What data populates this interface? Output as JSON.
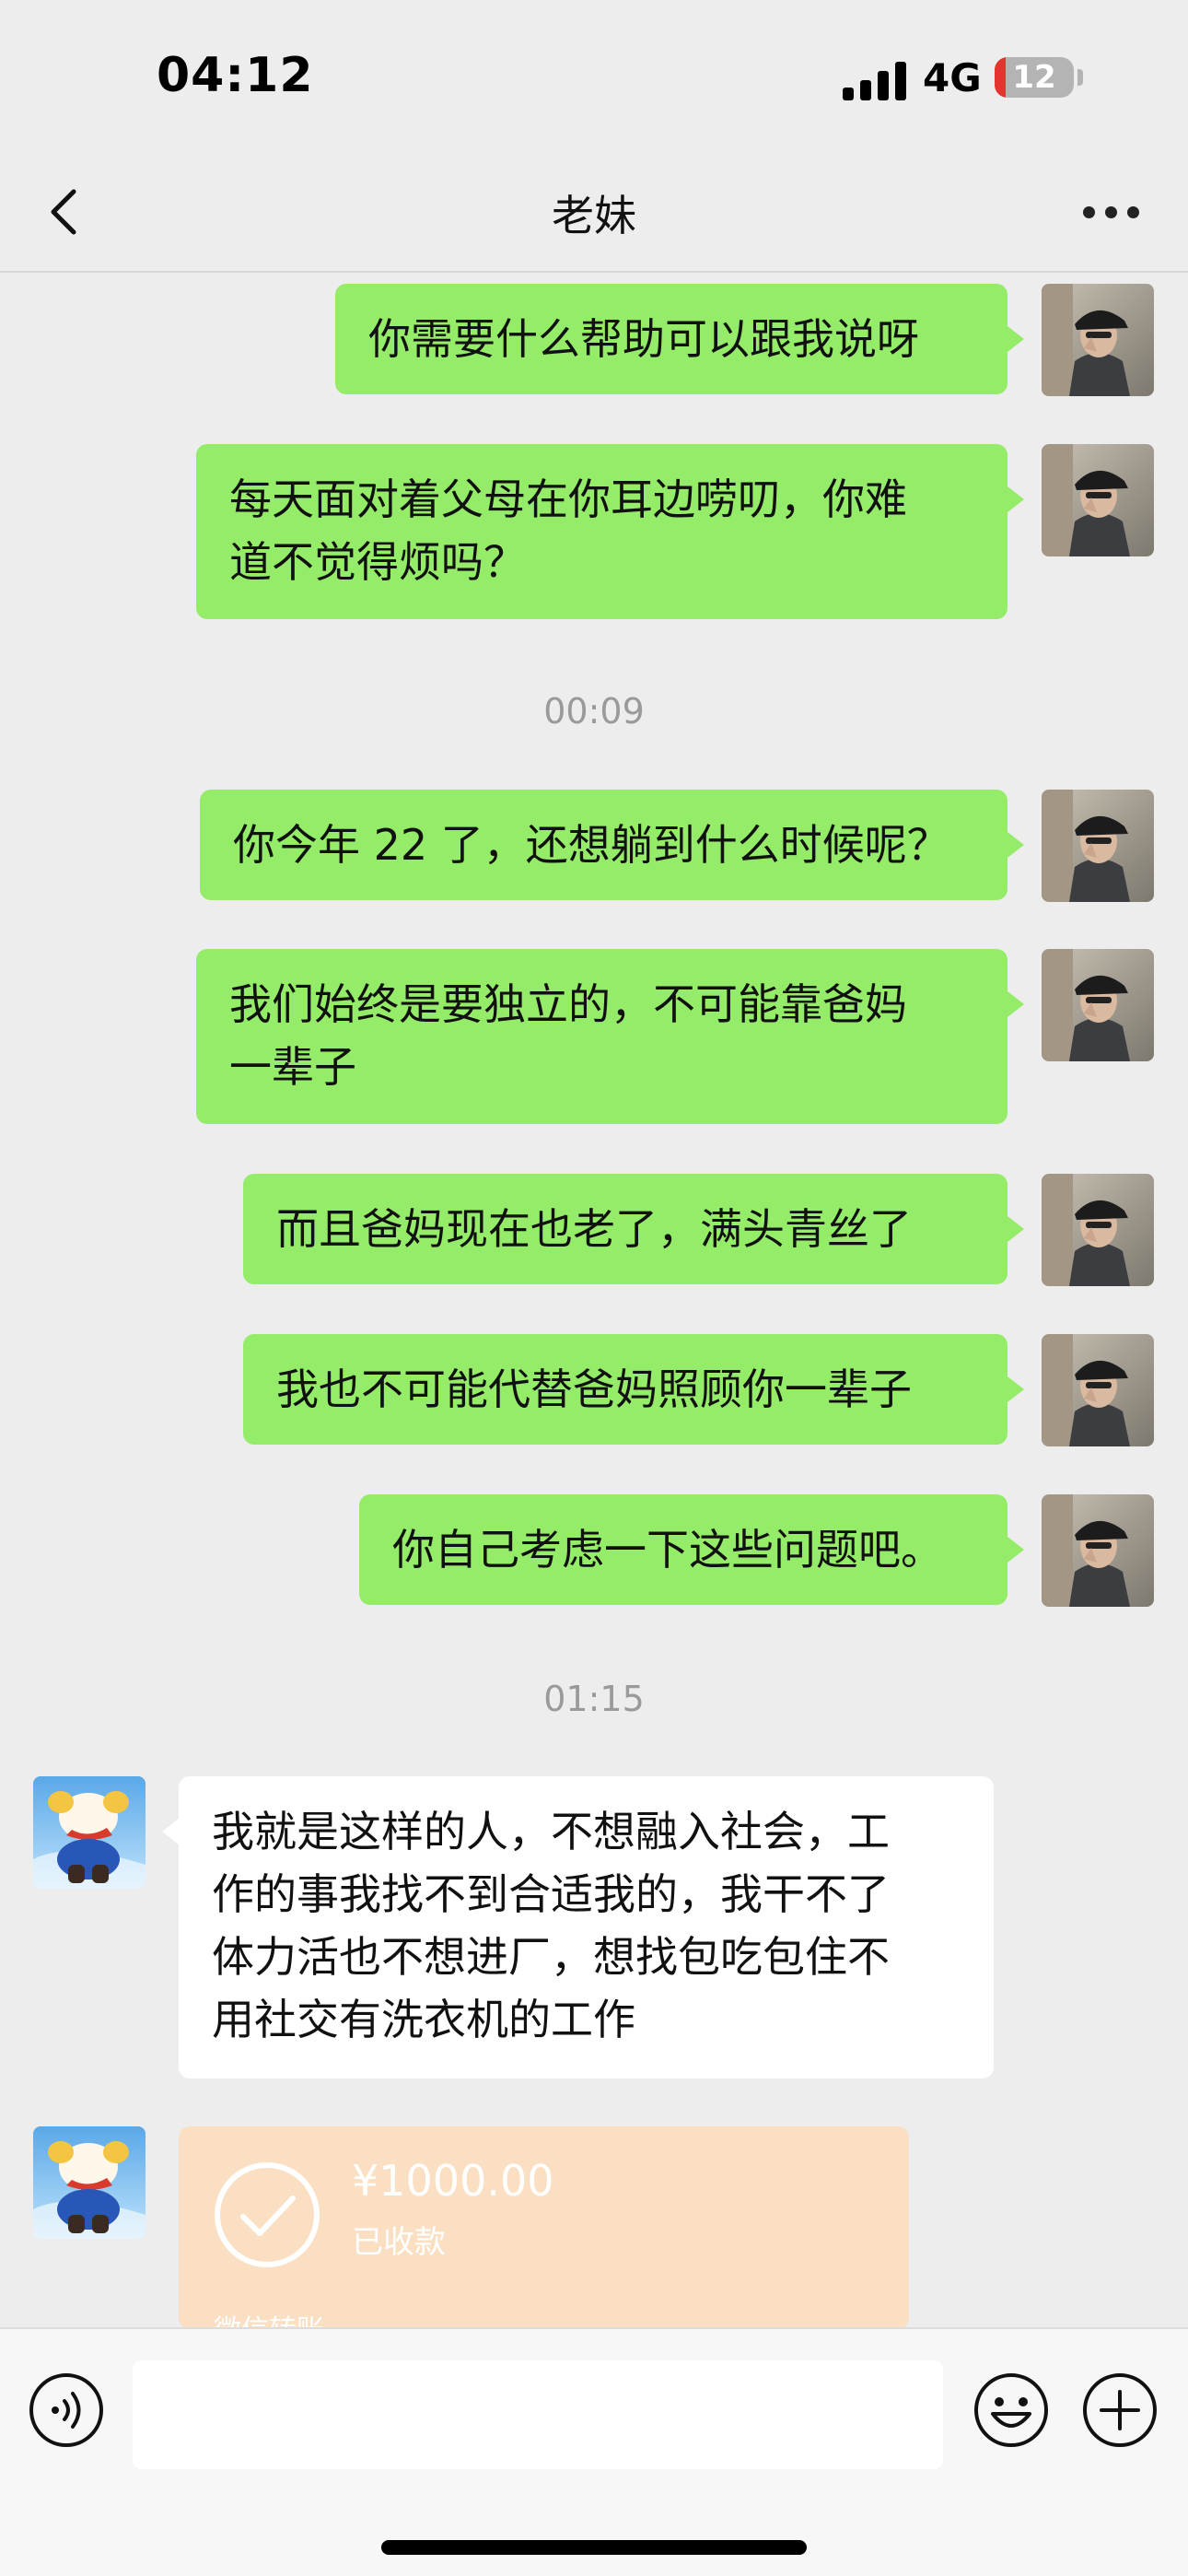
{
  "status_bar": {
    "time": "04:12",
    "network": "4G",
    "battery": "12"
  },
  "header": {
    "title": "老妹"
  },
  "timestamps": [
    "00:09",
    "01:15"
  ],
  "messages": [
    {
      "sender": "self",
      "text": "你需要什么帮助可以跟我说呀"
    },
    {
      "sender": "self",
      "lines": [
        "每天面对着父母在你耳边唠叨，你难",
        "道不觉得烦吗？"
      ]
    },
    {
      "sender": "self",
      "text": "你今年 22 了，还想躺到什么时候呢？"
    },
    {
      "sender": "self",
      "lines": [
        "我们始终是要独立的，不可能靠爸妈",
        "一辈子"
      ]
    },
    {
      "sender": "self",
      "text": "而且爸妈现在也老了，满头青丝了"
    },
    {
      "sender": "self",
      "text": "我也不可能代替爸妈照顾你一辈子"
    },
    {
      "sender": "self",
      "text": "你自己考虑一下这些问题吧。"
    },
    {
      "sender": "other",
      "lines": [
        "我就是这样的人，不想融入社会，工",
        "作的事我找不到合适我的，我干不了",
        "体力活也不想进厂，想找包吃包住不",
        "用社交有洗衣机的工作"
      ]
    }
  ],
  "transfer": {
    "amount": "¥1000.00",
    "status": "已收款",
    "source": "微信转账"
  },
  "input_bar": {
    "value": ""
  },
  "icons": {
    "back": "chevron-left-icon",
    "more": "more-dots-icon",
    "voice": "voice-icon",
    "emoji": "emoji-icon",
    "plus": "plus-icon",
    "check": "check-circle-icon"
  },
  "colors": {
    "background": "#EDEDED",
    "self_bubble": "#95EC69",
    "other_bubble": "#FFFFFF",
    "transfer_card": "#FBDFC3",
    "battery_low": "#E5342F"
  }
}
